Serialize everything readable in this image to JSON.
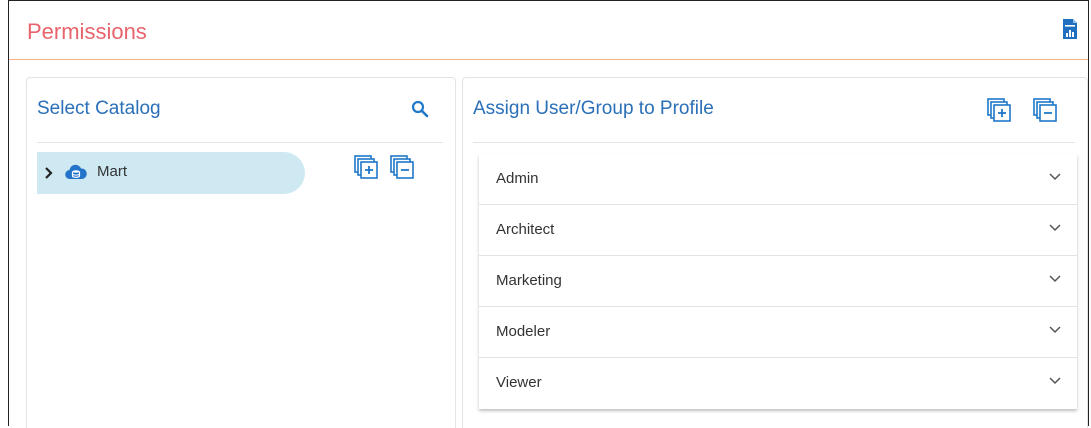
{
  "page": {
    "title": "Permissions",
    "report_icon": "report-icon"
  },
  "colors": {
    "title": "#e8646c",
    "accent_blue": "#2a6fb8",
    "selected_row": "#cfe9f3",
    "header_rule": "#f4b183"
  },
  "catalog_panel": {
    "title": "Select Catalog",
    "search_icon": "search-icon",
    "tree": [
      {
        "label": "Mart",
        "expander_icon": "chevron-right-icon",
        "node_icon": "cloud-database-icon",
        "selected": true
      }
    ],
    "actions": [
      {
        "name": "expand-all-button",
        "icon": "expand-all-icon"
      },
      {
        "name": "collapse-all-button",
        "icon": "collapse-all-icon"
      }
    ]
  },
  "profile_panel": {
    "title": "Assign User/Group to Profile",
    "actions": [
      {
        "name": "expand-all-button",
        "icon": "expand-all-icon"
      },
      {
        "name": "collapse-all-button",
        "icon": "collapse-all-icon"
      }
    ],
    "profiles": [
      {
        "label": "Admin"
      },
      {
        "label": "Architect"
      },
      {
        "label": "Marketing"
      },
      {
        "label": "Modeler"
      },
      {
        "label": "Viewer"
      }
    ]
  }
}
